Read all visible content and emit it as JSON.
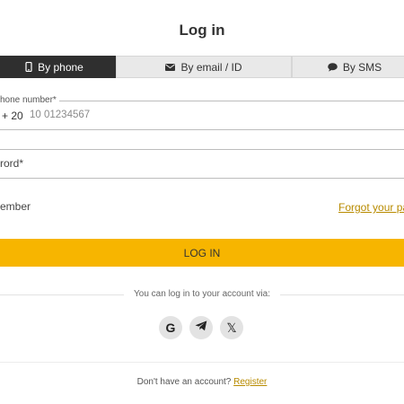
{
  "title": "Log in",
  "tabs": [
    {
      "label": "By phone",
      "icon": "phone-icon",
      "active": true
    },
    {
      "label": "By email / ID",
      "icon": "envelope-icon",
      "active": false
    },
    {
      "label": "By SMS",
      "icon": "chat-bubble-icon",
      "active": false
    }
  ],
  "phone": {
    "legend": "hone number*",
    "prefix": "+ 20",
    "placeholder": "10 01234567"
  },
  "password": {
    "label": "rord*"
  },
  "remember_label": "ember",
  "forgot_label": "Forgot your pa",
  "login_button": "LOG IN",
  "social": {
    "caption": "You can log in to your account via:",
    "providers": [
      {
        "name": "Google",
        "glyph": "G",
        "icon": "google-icon"
      },
      {
        "name": "Telegram",
        "icon": "telegram-icon"
      },
      {
        "name": "X",
        "glyph": "𝕏",
        "icon": "x-icon"
      }
    ]
  },
  "signup": {
    "prompt": "Don't have an account?",
    "link": "Register"
  },
  "colors": {
    "accent": "#f7b500",
    "link": "#b88b00",
    "active_tab": "#2f2f2f"
  }
}
